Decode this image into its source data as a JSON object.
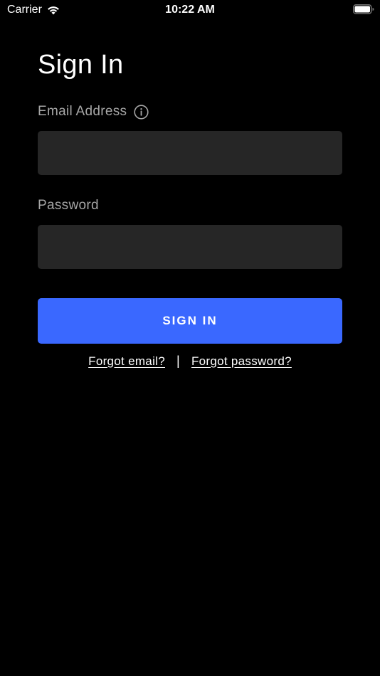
{
  "status_bar": {
    "carrier": "Carrier",
    "time": "10:22 AM",
    "wifi_icon": "wifi-icon",
    "battery_icon": "battery-icon"
  },
  "page": {
    "title": "Sign In"
  },
  "form": {
    "email_label": "Email Address",
    "email_info_icon": "info-icon",
    "email_value": "",
    "password_label": "Password",
    "password_value": "",
    "submit_label": "SIGN IN"
  },
  "links": {
    "forgot_email": "Forgot email?",
    "divider": "|",
    "forgot_password": "Forgot password?"
  },
  "colors": {
    "background": "#000000",
    "input_background": "#262626",
    "primary_button": "#3a68ff",
    "label_text": "#a6a6a6"
  }
}
